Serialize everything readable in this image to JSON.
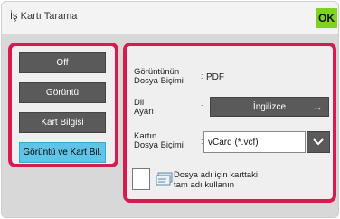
{
  "header": {
    "title": "İş Kartı Tarama",
    "ok_label": "OK"
  },
  "modes": [
    {
      "label": "Off",
      "active": false
    },
    {
      "label": "Görüntü",
      "active": false
    },
    {
      "label": "Kart Bilgisi",
      "active": false
    },
    {
      "label": "Görüntü ve Kart Bil.",
      "active": true
    }
  ],
  "settings": {
    "image_format_label_1": "Görüntünün",
    "image_format_label_2": "Dosya Biçimi",
    "image_format_value": "PDF",
    "language_label_1": "Dil",
    "language_label_2": "Ayarı",
    "language_value": "İngilizce",
    "card_format_label_1": "Kartın",
    "card_format_label_2": "Dosya Biçimi",
    "card_format_value": "vCard (*.vcf)",
    "checkbox_label_1": "Dosya adı için karttaki",
    "checkbox_label_2": "tam adı kullanın",
    "checkbox_checked": false
  },
  "colors": {
    "highlight_border": "#d61c4e",
    "ok_button": "#7ed321",
    "active_mode": "#5ec4e8"
  },
  "icons": [
    "right-arrow-icon",
    "chevron-down-icon",
    "card-icon"
  ]
}
